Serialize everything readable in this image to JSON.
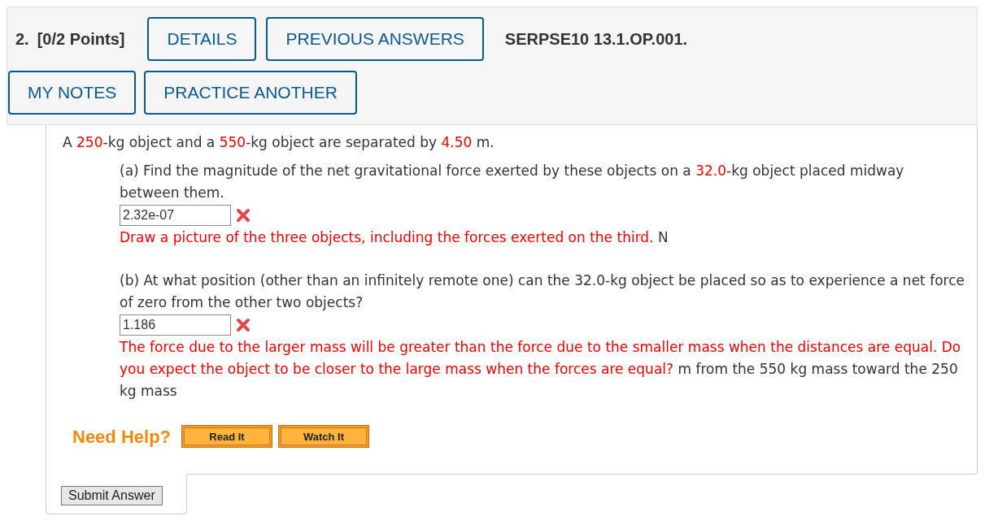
{
  "header": {
    "number": "2.",
    "points": "[0/2 Points]",
    "buttons": [
      "DETAILS",
      "PREVIOUS ANSWERS"
    ],
    "code": "SERPSE10 13.1.OP.001.",
    "buttons_row2": [
      "MY NOTES",
      "PRACTICE ANOTHER"
    ]
  },
  "question": {
    "segments": [
      {
        "kind": "plain",
        "text": "A "
      },
      {
        "kind": "value",
        "text": "250"
      },
      {
        "kind": "plain",
        "text": "-kg object and a "
      },
      {
        "kind": "value",
        "text": "550"
      },
      {
        "kind": "plain",
        "text": "-kg object are separated by "
      },
      {
        "kind": "value",
        "text": "4.50"
      },
      {
        "kind": "plain",
        "text": " m."
      }
    ]
  },
  "parts": [
    {
      "segments": [
        {
          "kind": "plain",
          "text": "(a) Find the magnitude of the net gravitational force exerted by these objects on a "
        },
        {
          "kind": "value",
          "text": "32.0"
        },
        {
          "kind": "plain",
          "text": "-kg object placed midway between them."
        }
      ],
      "answer": "2.32e-07",
      "correct": false,
      "feedback": [
        {
          "kind": "value",
          "text": "Draw a picture of the three objects, including the forces exerted on the third."
        },
        {
          "kind": "plain",
          "text": " N"
        }
      ]
    },
    {
      "segments": [
        {
          "kind": "plain",
          "text": "(b) At what position (other than an infinitely remote one) can the 32.0-kg object be placed so as to experience a net force of zero from the other two objects?"
        }
      ],
      "answer": "1.186",
      "correct": false,
      "feedback": [
        {
          "kind": "value",
          "text": "The force due to the larger mass will be greater than the force due to the smaller mass when the distances are equal. Do you expect the object to be closer to the large mass when the forces are equal?"
        },
        {
          "kind": "plain",
          "text": " m from the 550 kg mass toward the 250 kg mass"
        }
      ]
    }
  ],
  "help": {
    "label": "Need Help?",
    "buttons": [
      "Read It",
      "Watch It"
    ]
  },
  "submit": "Submit Answer"
}
